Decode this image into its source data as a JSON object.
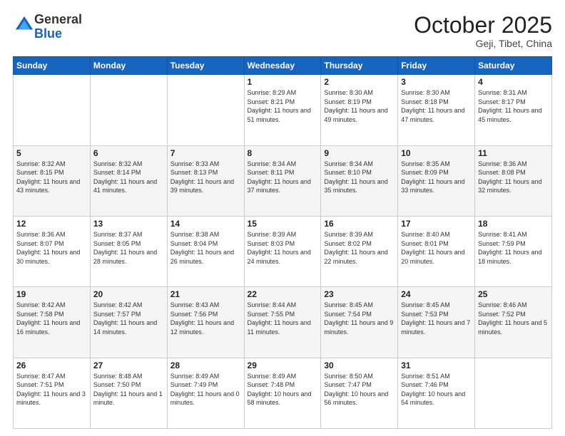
{
  "header": {
    "logo": {
      "general": "General",
      "blue": "Blue"
    },
    "title": "October 2025",
    "subtitle": "Geji, Tibet, China"
  },
  "weekdays": [
    "Sunday",
    "Monday",
    "Tuesday",
    "Wednesday",
    "Thursday",
    "Friday",
    "Saturday"
  ],
  "weeks": [
    [
      {
        "day": "",
        "info": ""
      },
      {
        "day": "",
        "info": ""
      },
      {
        "day": "",
        "info": ""
      },
      {
        "day": "1",
        "info": "Sunrise: 8:29 AM\nSunset: 8:21 PM\nDaylight: 11 hours\nand 51 minutes."
      },
      {
        "day": "2",
        "info": "Sunrise: 8:30 AM\nSunset: 8:19 PM\nDaylight: 11 hours\nand 49 minutes."
      },
      {
        "day": "3",
        "info": "Sunrise: 8:30 AM\nSunset: 8:18 PM\nDaylight: 11 hours\nand 47 minutes."
      },
      {
        "day": "4",
        "info": "Sunrise: 8:31 AM\nSunset: 8:17 PM\nDaylight: 11 hours\nand 45 minutes."
      }
    ],
    [
      {
        "day": "5",
        "info": "Sunrise: 8:32 AM\nSunset: 8:15 PM\nDaylight: 11 hours\nand 43 minutes."
      },
      {
        "day": "6",
        "info": "Sunrise: 8:32 AM\nSunset: 8:14 PM\nDaylight: 11 hours\nand 41 minutes."
      },
      {
        "day": "7",
        "info": "Sunrise: 8:33 AM\nSunset: 8:13 PM\nDaylight: 11 hours\nand 39 minutes."
      },
      {
        "day": "8",
        "info": "Sunrise: 8:34 AM\nSunset: 8:11 PM\nDaylight: 11 hours\nand 37 minutes."
      },
      {
        "day": "9",
        "info": "Sunrise: 8:34 AM\nSunset: 8:10 PM\nDaylight: 11 hours\nand 35 minutes."
      },
      {
        "day": "10",
        "info": "Sunrise: 8:35 AM\nSunset: 8:09 PM\nDaylight: 11 hours\nand 33 minutes."
      },
      {
        "day": "11",
        "info": "Sunrise: 8:36 AM\nSunset: 8:08 PM\nDaylight: 11 hours\nand 32 minutes."
      }
    ],
    [
      {
        "day": "12",
        "info": "Sunrise: 8:36 AM\nSunset: 8:07 PM\nDaylight: 11 hours\nand 30 minutes."
      },
      {
        "day": "13",
        "info": "Sunrise: 8:37 AM\nSunset: 8:05 PM\nDaylight: 11 hours\nand 28 minutes."
      },
      {
        "day": "14",
        "info": "Sunrise: 8:38 AM\nSunset: 8:04 PM\nDaylight: 11 hours\nand 26 minutes."
      },
      {
        "day": "15",
        "info": "Sunrise: 8:39 AM\nSunset: 8:03 PM\nDaylight: 11 hours\nand 24 minutes."
      },
      {
        "day": "16",
        "info": "Sunrise: 8:39 AM\nSunset: 8:02 PM\nDaylight: 11 hours\nand 22 minutes."
      },
      {
        "day": "17",
        "info": "Sunrise: 8:40 AM\nSunset: 8:01 PM\nDaylight: 11 hours\nand 20 minutes."
      },
      {
        "day": "18",
        "info": "Sunrise: 8:41 AM\nSunset: 7:59 PM\nDaylight: 11 hours\nand 18 minutes."
      }
    ],
    [
      {
        "day": "19",
        "info": "Sunrise: 8:42 AM\nSunset: 7:58 PM\nDaylight: 11 hours\nand 16 minutes."
      },
      {
        "day": "20",
        "info": "Sunrise: 8:42 AM\nSunset: 7:57 PM\nDaylight: 11 hours\nand 14 minutes."
      },
      {
        "day": "21",
        "info": "Sunrise: 8:43 AM\nSunset: 7:56 PM\nDaylight: 11 hours\nand 12 minutes."
      },
      {
        "day": "22",
        "info": "Sunrise: 8:44 AM\nSunset: 7:55 PM\nDaylight: 11 hours\nand 11 minutes."
      },
      {
        "day": "23",
        "info": "Sunrise: 8:45 AM\nSunset: 7:54 PM\nDaylight: 11 hours\nand 9 minutes."
      },
      {
        "day": "24",
        "info": "Sunrise: 8:45 AM\nSunset: 7:53 PM\nDaylight: 11 hours\nand 7 minutes."
      },
      {
        "day": "25",
        "info": "Sunrise: 8:46 AM\nSunset: 7:52 PM\nDaylight: 11 hours\nand 5 minutes."
      }
    ],
    [
      {
        "day": "26",
        "info": "Sunrise: 8:47 AM\nSunset: 7:51 PM\nDaylight: 11 hours\nand 3 minutes."
      },
      {
        "day": "27",
        "info": "Sunrise: 8:48 AM\nSunset: 7:50 PM\nDaylight: 11 hours\nand 1 minute."
      },
      {
        "day": "28",
        "info": "Sunrise: 8:49 AM\nSunset: 7:49 PM\nDaylight: 11 hours\nand 0 minutes."
      },
      {
        "day": "29",
        "info": "Sunrise: 8:49 AM\nSunset: 7:48 PM\nDaylight: 10 hours\nand 58 minutes."
      },
      {
        "day": "30",
        "info": "Sunrise: 8:50 AM\nSunset: 7:47 PM\nDaylight: 10 hours\nand 56 minutes."
      },
      {
        "day": "31",
        "info": "Sunrise: 8:51 AM\nSunset: 7:46 PM\nDaylight: 10 hours\nand 54 minutes."
      },
      {
        "day": "",
        "info": ""
      }
    ]
  ]
}
